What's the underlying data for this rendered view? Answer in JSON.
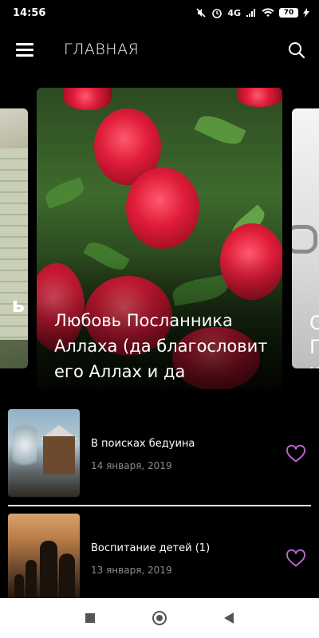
{
  "status": {
    "time": "14:56",
    "network": "4G",
    "battery": "70"
  },
  "appbar": {
    "title": "ГЛАВНАЯ",
    "menu_icon": "menu-icon",
    "search_icon": "search-icon"
  },
  "carousel": {
    "left_fragment": "ь",
    "main_headline": "Любовь Посланника Аллаха (да благословит его Аллах и да",
    "right_fragment": "С\nП\nч"
  },
  "articles": [
    {
      "title": "В поисках бедуина",
      "date": "14 января, 2019"
    },
    {
      "title": "Воспитание детей (1)",
      "date": "13 января, 2019"
    }
  ],
  "colors": {
    "accent_heart": "#c36bd6",
    "background": "#000000",
    "date_text": "#8c8c8c"
  }
}
